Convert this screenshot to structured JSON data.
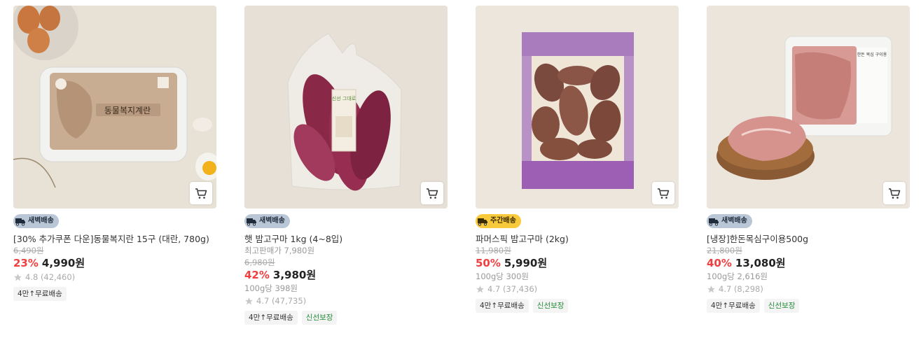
{
  "products": [
    {
      "badge": "새벽배송",
      "badge_type": "dawn",
      "name": "[30% 추가쿠폰 다운]동물복지란 15구 (대란, 780g)",
      "best_price": "",
      "original_price": "6,490원",
      "discount": "23%",
      "price": "4,990원",
      "unit_price": "",
      "rating": "4.8 (42,460)",
      "tags": [
        "4만↑무료배송"
      ],
      "image_icon": "egg-carton-image",
      "package_label": "동물복지계란"
    },
    {
      "badge": "새벽배송",
      "badge_type": "dawn",
      "name": "햇 밤고구마 1kg (4~8입)",
      "best_price": "최고판매가 7,980원",
      "original_price": "6,980원",
      "discount": "42%",
      "price": "3,980원",
      "unit_price": "100g당 398원",
      "rating": "4.7 (47,735)",
      "tags": [
        "4만↑무료배송",
        "신선보장"
      ],
      "image_icon": "sweet-potato-bag-image",
      "package_label": "신선 그대로"
    },
    {
      "badge": "주간배송",
      "badge_type": "weekly",
      "name": "파머스픽 밤고구마 (2kg)",
      "best_price": "",
      "original_price": "11,980원",
      "discount": "50%",
      "price": "5,990원",
      "unit_price": "100g당 300원",
      "rating": "4.7 (37,436)",
      "tags": [
        "4만↑무료배송",
        "신선보장"
      ],
      "image_icon": "sweet-potato-box-image",
      "package_label": ""
    },
    {
      "badge": "새벽배송",
      "badge_type": "dawn",
      "name": "[냉장]한돈목심구이용500g",
      "best_price": "",
      "original_price": "21,800원",
      "discount": "40%",
      "price": "13,080원",
      "unit_price": "100g당 2,616원",
      "rating": "4.7 (8,298)",
      "tags": [
        "4만↑무료배송",
        "신선보장"
      ],
      "image_icon": "pork-neck-image",
      "package_label": "한돈 목심 구이용"
    }
  ],
  "colors": {
    "discount": "#f03f40",
    "dawn_badge": "#b9c6d6",
    "weekly_badge": "#f8c93a",
    "fresh_tag": "#238b38"
  }
}
